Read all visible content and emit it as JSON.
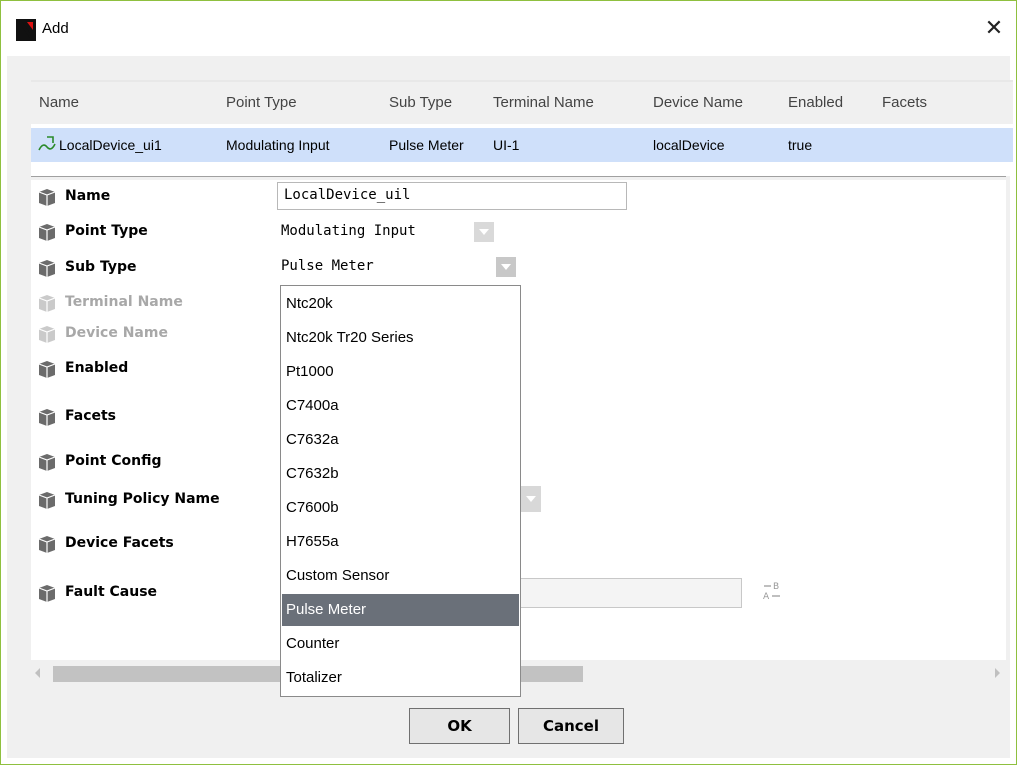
{
  "window": {
    "title": "Add",
    "logo": "N",
    "close_glyph": "✕"
  },
  "table": {
    "columns": [
      "Name",
      "Point Type",
      "Sub Type",
      "Terminal Name",
      "Device Name",
      "Enabled",
      "Facets"
    ],
    "row": {
      "name": "LocalDevice_ui1",
      "point_type": "Modulating Input",
      "sub_type": "Pulse Meter",
      "terminal_name": "UI-1",
      "device_name": "localDevice",
      "enabled": "true",
      "facets": ""
    }
  },
  "properties": {
    "name": {
      "label": "Name",
      "value": "LocalDevice_uil"
    },
    "point_type": {
      "label": "Point Type",
      "value": "Modulating Input"
    },
    "sub_type": {
      "label": "Sub Type",
      "value": "Pulse Meter"
    },
    "terminal_name": {
      "label": "Terminal Name"
    },
    "device_name": {
      "label": "Device Name"
    },
    "enabled": {
      "label": "Enabled"
    },
    "facets": {
      "label": "Facets"
    },
    "point_config": {
      "label": "Point Config"
    },
    "tuning_policy_name": {
      "label": "Tuning Policy Name"
    },
    "device_facets": {
      "label": "Device Facets"
    },
    "fault_cause": {
      "label": "Fault Cause"
    }
  },
  "dropdown": {
    "options": [
      "Ntc20k",
      "Ntc20k Tr20 Series",
      "Pt1000",
      "C7400a",
      "C7632a",
      "C7632b",
      "C7600b",
      "H7655a",
      "Custom Sensor",
      "Pulse Meter",
      "Counter",
      "Totalizer"
    ],
    "selected": "Pulse Meter"
  },
  "buttons": {
    "ok": "OK",
    "cancel": "Cancel"
  },
  "icons": {
    "app": "niagara-logo-icon",
    "row": "point-signal-icon",
    "property": "slot-cube-icon",
    "text_format": "ab-format-icon"
  },
  "colors": {
    "selection": "#cfe0fa",
    "dropdown_selected": "#6a7079",
    "window_border": "#8fc03f"
  }
}
